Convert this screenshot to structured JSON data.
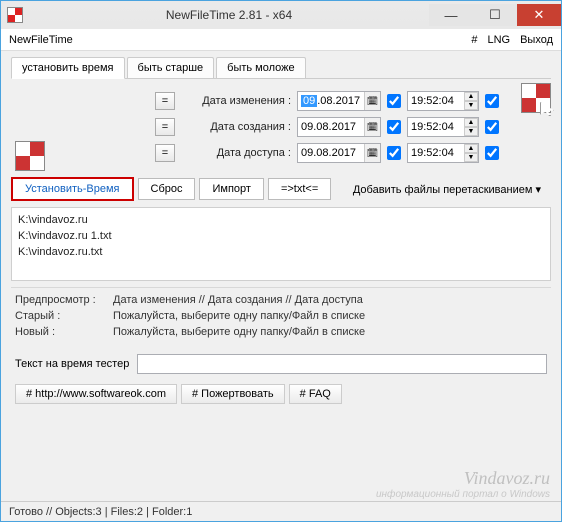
{
  "window": {
    "title": "NewFileTime 2.81 - x64"
  },
  "menubar": {
    "app": "NewFileTime",
    "hash": "#",
    "lng": "LNG",
    "exit": "Выход"
  },
  "tabs": {
    "set_time": "установить время",
    "be_older": "быть старше",
    "be_younger": "быть моложе"
  },
  "rows": {
    "eq": "=",
    "modified_label": "Дата изменения :",
    "created_label": "Дата создания :",
    "accessed_label": "Дата доступа :",
    "date_sel": "09",
    "date_rest": ".08.2017",
    "date_full": "09.08.2017",
    "time": "19:52:04"
  },
  "buttons": {
    "set_time": "Установить-Время",
    "reset": "Сброс",
    "import": "Импорт",
    "txt": "=>txt<=",
    "add_drag": "Добавить файлы перетаскиванием",
    "arrow": "▾"
  },
  "files": {
    "f1": "K:\\vindavoz.ru",
    "f2": "K:\\vindavoz.ru 1.txt",
    "f3": "K:\\vindavoz.ru.txt"
  },
  "preview": {
    "header_label": "Предпросмотр :",
    "header_cols": "Дата изменения    //    Дата создания    //    Дата доступа",
    "old_label": "Старый :",
    "new_label": "Новый :",
    "msg": "Пожалуйста, выберите одну папку/Файл в списке"
  },
  "texttest": {
    "label": "Текст на время тестер",
    "value": ""
  },
  "links": {
    "site": "# http://www.softwareok.com",
    "donate": "# Пожертвовать",
    "faq": "# FAQ"
  },
  "status": {
    "text": "Готово // Objects:3 | Files:2 | Folder:1"
  },
  "watermark": {
    "big": "Vindavoz.ru",
    "small": "информационный портал о Windows"
  }
}
